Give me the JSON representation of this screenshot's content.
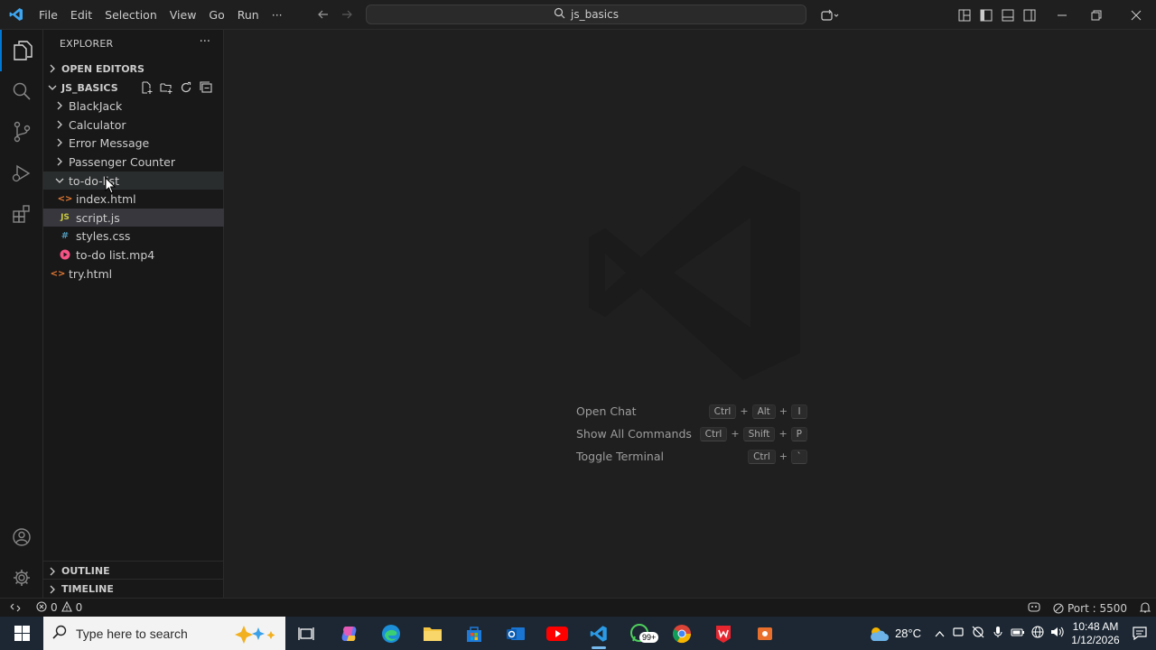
{
  "app": {
    "search_text": "js_basics"
  },
  "menu": [
    "File",
    "Edit",
    "Selection",
    "View",
    "Go",
    "Run",
    "···"
  ],
  "sidebar": {
    "title": "EXPLORER",
    "more": "···",
    "open_editors": "OPEN EDITORS",
    "project": "JS_BASICS",
    "tree": [
      {
        "label": "BlackJack",
        "type": "folder"
      },
      {
        "label": "Calculator",
        "type": "folder"
      },
      {
        "label": "Error Message",
        "type": "folder"
      },
      {
        "label": "Passenger Counter",
        "type": "folder"
      },
      {
        "label": "to-do-list",
        "type": "folder-open"
      },
      {
        "label": "index.html",
        "type": "html"
      },
      {
        "label": "script.js",
        "type": "js"
      },
      {
        "label": "styles.css",
        "type": "css"
      },
      {
        "label": "to-do list.mp4",
        "type": "mp4"
      },
      {
        "label": "try.html",
        "type": "html"
      }
    ],
    "outline": "OUTLINE",
    "timeline": "TIMELINE"
  },
  "editor": {
    "shortcuts": [
      {
        "label": "Open Chat",
        "keys": [
          "Ctrl",
          "Alt",
          "I"
        ]
      },
      {
        "label": "Show All Commands",
        "keys": [
          "Ctrl",
          "Shift",
          "P"
        ]
      },
      {
        "label": "Toggle Terminal",
        "keys": [
          "Ctrl",
          "`"
        ]
      }
    ]
  },
  "statusbar": {
    "errors": "0",
    "warnings": "0",
    "port": "Port : 5500"
  },
  "taskbar": {
    "search_placeholder": "Type here to search",
    "weather": "28°C",
    "time": "10:48 AM",
    "date": "1/12/2026",
    "whatsapp_badge": "99+"
  },
  "colors": {
    "accent": "#0078d4",
    "sidebar_bg": "#181818",
    "editor_bg": "#1f1f1f",
    "taskbar_bg": "#1c2733"
  }
}
